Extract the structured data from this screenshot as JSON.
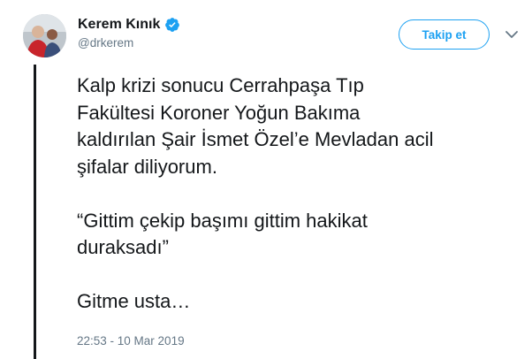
{
  "user": {
    "display_name": "Kerem Kınık",
    "handle": "@drkerem",
    "verified": true,
    "avatar_icon": "profile-photo"
  },
  "actions": {
    "follow_label": "Takip et",
    "menu_icon": "chevron-down-icon"
  },
  "tweet": {
    "paragraphs": [
      "Kalp krizi sonucu Cerrahpaşa Tıp\nFakültesi Koroner Yoğun Bakıma\nkaldırılan Şair İsmet Özel’e Mevladan acil\nşifalar diliyorum.",
      "“Gittim çekip başımı gittim hakikat\nduraksadı”",
      "Gitme usta…"
    ],
    "timestamp": "22:53 - 10 Mar 2019"
  },
  "colors": {
    "accent": "#1da1f2",
    "text": "#14171a",
    "muted": "#657786"
  }
}
